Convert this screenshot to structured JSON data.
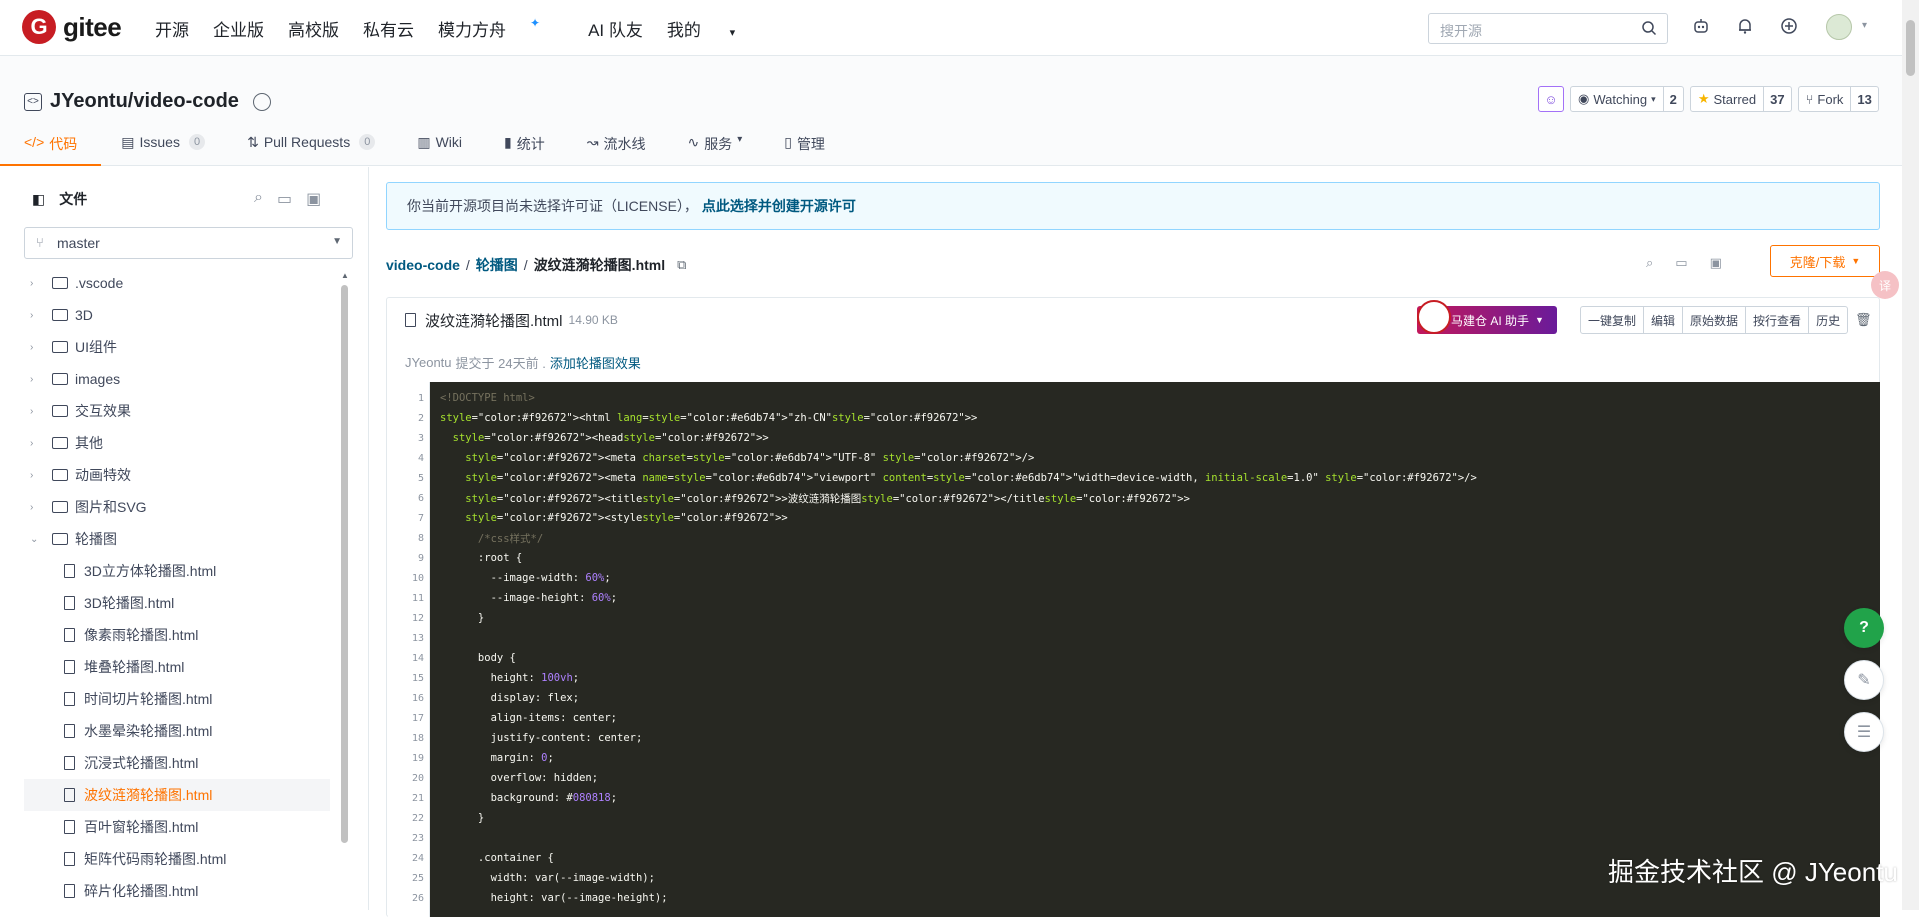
{
  "logo": {
    "mark": "G",
    "text": "gitee"
  },
  "nav": [
    "开源",
    "企业版",
    "高校版",
    "私有云",
    "模力方舟",
    "AI 队友",
    "我的"
  ],
  "nav_spark": "✦",
  "search": {
    "placeholder": "搜开源"
  },
  "repo": {
    "title": "JYeontu/video-code"
  },
  "repo_actions": {
    "watching": {
      "label": "Watching",
      "count": "2"
    },
    "starred": {
      "label": "Starred",
      "count": "37"
    },
    "fork": {
      "label": "Fork",
      "count": "13"
    }
  },
  "tabs": [
    {
      "label": "代码",
      "count": ""
    },
    {
      "label": "Issues",
      "count": "0"
    },
    {
      "label": "Pull Requests",
      "count": "0"
    },
    {
      "label": "Wiki",
      "count": ""
    },
    {
      "label": "统计",
      "count": ""
    },
    {
      "label": "流水线",
      "count": ""
    },
    {
      "label": "服务",
      "count": ""
    },
    {
      "label": "管理",
      "count": ""
    }
  ],
  "sidebar": {
    "title": "文件",
    "branch": "master",
    "folders": [
      ".vscode",
      "3D",
      "UI组件",
      "images",
      "交互效果",
      "其他",
      "动画特效",
      "图片和SVG",
      "轮播图"
    ],
    "files": [
      "3D立方体轮播图.html",
      "3D轮播图.html",
      "像素雨轮播图.html",
      "堆叠轮播图.html",
      "时间切片轮播图.html",
      "水墨晕染轮播图.html",
      "沉浸式轮播图.html",
      "波纹涟漪轮播图.html",
      "百叶窗轮播图.html",
      "矩阵代码雨轮播图.html",
      "碎片化轮播图.html"
    ]
  },
  "license": {
    "text": "你当前开源项目尚未选择许可证（LICENSE），",
    "link": "点此选择并创建开源许可"
  },
  "breadcrumb": {
    "root": "video-code",
    "folder": "轮播图",
    "file": "波纹涟漪轮播图.html"
  },
  "clone_label": "克隆/下载",
  "translate_badge": "译",
  "file": {
    "name": "波纹涟漪轮播图.html",
    "size": "14.90 KB",
    "ai_label": "马建仓 AI 助手",
    "buttons": [
      "一键复制",
      "编辑",
      "原始数据",
      "按行查看",
      "历史"
    ],
    "commit_author": "JYeontu",
    "commit_time": "提交于 24天前 .",
    "commit_msg": "添加轮播图效果"
  },
  "code_lines": [
    "<!DOCTYPE html>",
    "<html lang=\"zh-CN\">",
    "  <head>",
    "    <meta charset=\"UTF-8\" />",
    "    <meta name=\"viewport\" content=\"width=device-width, initial-scale=1.0\" />",
    "    <title>波纹涟漪轮播图</title>",
    "    <style>",
    "      /*css样式*/",
    "      :root {",
    "        --image-width: 60%;",
    "        --image-height: 60%;",
    "      }",
    "",
    "      body {",
    "        height: 100vh;",
    "        display: flex;",
    "        align-items: center;",
    "        justify-content: center;",
    "        margin: 0;",
    "        overflow: hidden;",
    "        background: #080818;",
    "      }",
    "",
    "      .container {",
    "        width: var(--image-width);",
    "        height: var(--image-height);"
  ],
  "float": {
    "help": "?"
  },
  "watermark": "掘金技术社区 @ JYeontu"
}
